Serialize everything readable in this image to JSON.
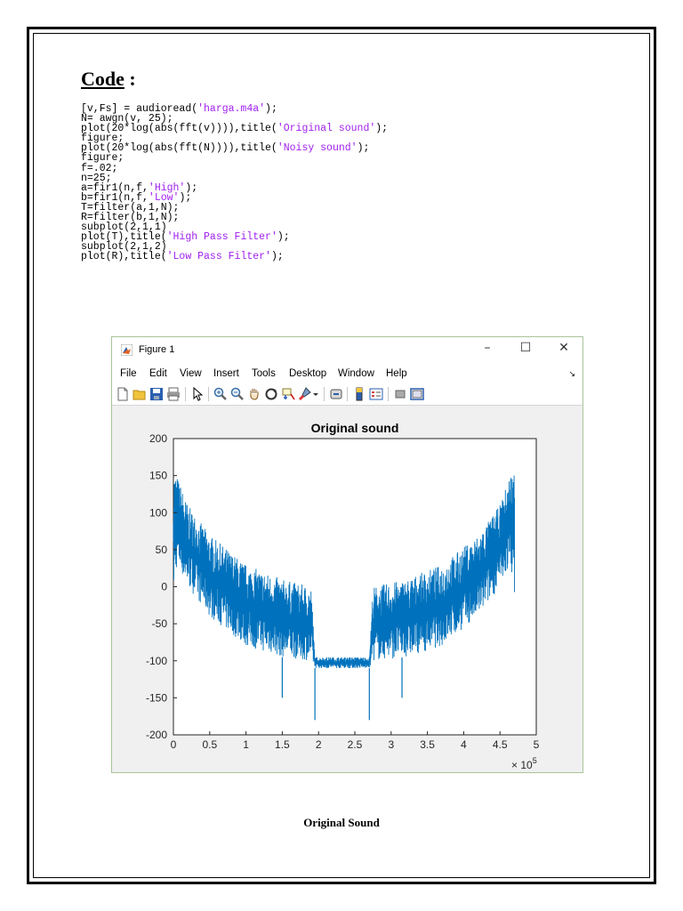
{
  "document": {
    "heading": "Code",
    "heading_suffix": " :",
    "code_lines": [
      [
        {
          "t": "[v,Fs] = audioread("
        },
        {
          "t": "'harga.m4a'",
          "s": true
        },
        {
          "t": ");"
        }
      ],
      [
        {
          "t": "N= awgn(v, 25);"
        }
      ],
      [
        {
          "t": "plot(20*log(abs(fft(v)))),title("
        },
        {
          "t": "'Original sound'",
          "s": true
        },
        {
          "t": ");"
        }
      ],
      [
        {
          "t": "figure;"
        }
      ],
      [
        {
          "t": "plot(20*log(abs(fft(N)))),title("
        },
        {
          "t": "'Noisy sound'",
          "s": true
        },
        {
          "t": ");"
        }
      ],
      [
        {
          "t": "figure;"
        }
      ],
      [
        {
          "t": "f=.02;"
        }
      ],
      [
        {
          "t": "n=25;"
        }
      ],
      [
        {
          "t": "a=fir1(n,f,"
        },
        {
          "t": "'High'",
          "s": true
        },
        {
          "t": ");"
        }
      ],
      [
        {
          "t": "b=fir1(n,f,"
        },
        {
          "t": "'Low'",
          "s": true
        },
        {
          "t": ");"
        }
      ],
      [
        {
          "t": "T=filter(a,1,N);"
        }
      ],
      [
        {
          "t": "R=filter(b,1,N);"
        }
      ],
      [
        {
          "t": "subplot(2,1,1)"
        }
      ],
      [
        {
          "t": "plot(T),title("
        },
        {
          "t": "'High Pass Filter'",
          "s": true
        },
        {
          "t": ");"
        }
      ],
      [
        {
          "t": "subplot(2,1,2)"
        }
      ],
      [
        {
          "t": "plot(R),title("
        },
        {
          "t": "'Low Pass Filter'",
          "s": true
        },
        {
          "t": ");"
        }
      ]
    ],
    "caption": "Original Sound"
  },
  "figure_window": {
    "title": "Figure 1",
    "buttons": {
      "minimize": "–",
      "maximize": "☐",
      "close": "✕"
    },
    "menu": [
      "File",
      "Edit",
      "View",
      "Insert",
      "Tools",
      "Desktop",
      "Window",
      "Help"
    ],
    "dock_glyph": "↘",
    "toolbar_icons": [
      "new-figure-icon",
      "open-file-icon",
      "save-icon",
      "print-icon",
      "pointer-icon",
      "zoom-in-icon",
      "zoom-out-icon",
      "pan-icon",
      "rotate-icon",
      "data-cursor-icon",
      "brush-icon",
      "dropdown-arrow-icon",
      "link-plot-icon",
      "colorbar-icon",
      "legend-icon",
      "hide-plot-tools-icon",
      "show-plot-tools-icon"
    ],
    "plot_color": "#0072bd",
    "accent": "#a9c49a"
  },
  "chart_data": {
    "type": "line",
    "title": "Original sound",
    "xlabel": "",
    "ylabel": "",
    "xlim": [
      0,
      500000
    ],
    "ylim": [
      -200,
      200
    ],
    "xticks": [
      0,
      50000,
      100000,
      150000,
      200000,
      250000,
      300000,
      350000,
      400000,
      450000,
      500000
    ],
    "xtick_labels": [
      "0",
      "0.5",
      "1",
      "1.5",
      "2",
      "2.5",
      "3",
      "3.5",
      "4",
      "4.5",
      "5"
    ],
    "x_exponent": "× 10",
    "x_exponent_power": "5",
    "yticks": [
      200,
      150,
      100,
      50,
      0,
      -50,
      -100,
      -150,
      -200
    ],
    "ytick_labels": [
      "200",
      "150",
      "100",
      "50",
      "0",
      "-50",
      "-100",
      "-150",
      "-200"
    ],
    "grid": false,
    "series": [
      {
        "color": "#0072bd",
        "x": [
          0,
          5000,
          20000,
          50000,
          100000,
          150000,
          190000,
          195000,
          270000,
          275000,
          320000,
          370000,
          420000,
          450000,
          465000,
          470000
        ],
        "upper": [
          160,
          150,
          110,
          70,
          30,
          10,
          0,
          -95,
          -95,
          0,
          10,
          30,
          70,
          110,
          155,
          160
        ],
        "lower": [
          -10,
          30,
          0,
          -40,
          -80,
          -95,
          -100,
          -110,
          -110,
          -100,
          -95,
          -80,
          -40,
          0,
          30,
          -10
        ],
        "spikes_down": [
          [
            195000,
            -180
          ],
          [
            270000,
            -180
          ],
          [
            150000,
            -150
          ],
          [
            315000,
            -150
          ]
        ]
      }
    ]
  }
}
